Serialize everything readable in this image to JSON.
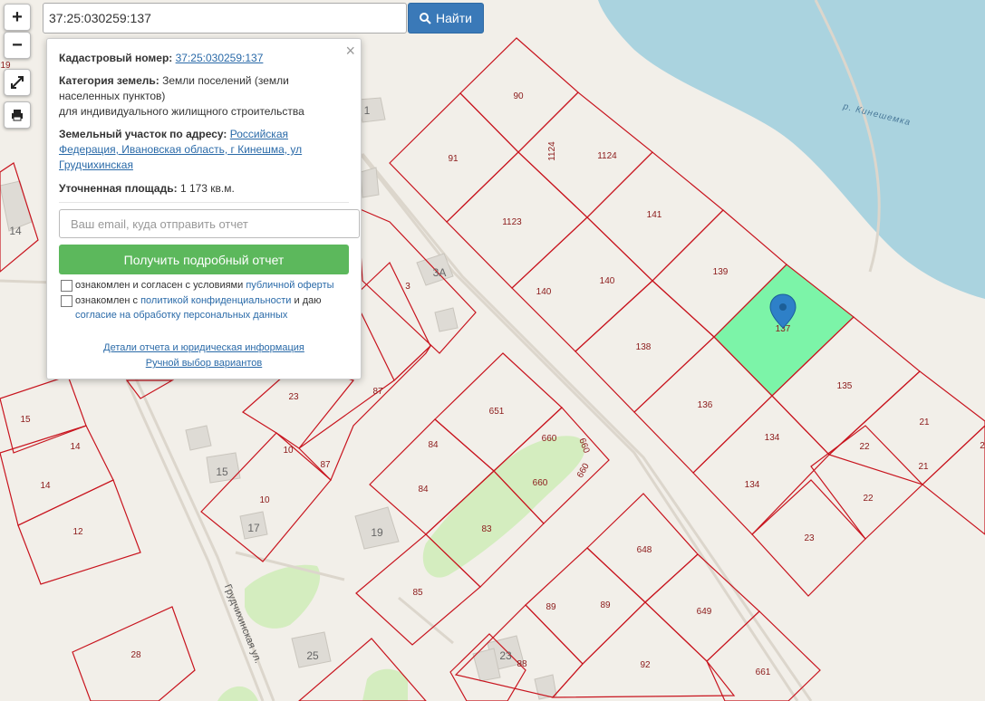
{
  "search": {
    "value": "37:25:030259:137",
    "button": "Найти"
  },
  "controls": {
    "zoom_in": "+",
    "zoom_out": "−"
  },
  "popup": {
    "close": "×",
    "cadastral_label": "Кадастровый номер:",
    "cadastral_value": "37:25:030259:137",
    "category_label": "Категория земель:",
    "category_value": "Земли поселений (земли населенных пунктов)",
    "category_use": "для индивидуального жилищного строительства",
    "address_label": "Земельный участок по адресу:",
    "address_value": "Российская Федерация, Ивановская область, г Кинешма, ул Грудчихинская",
    "area_label": "Уточненная площадь:",
    "area_value": "1 173 кв.м.",
    "email_placeholder": "Ваш email, куда отправить отчет",
    "report_button": "Получить подробный отчет",
    "check1_text": "ознакомлен и согласен с условиями",
    "check1_link": "публичной оферты",
    "check2_text": "ознакомлен с",
    "check2_link": "политикой конфиденциальности",
    "check2_and": "и даю",
    "check2_link2": "согласие на обработку персональных данных",
    "details_link": "Детали отчета и юридическая информация",
    "manual_link": "Ручной выбор вариантов"
  },
  "map": {
    "river_label": "р. Кинешемка",
    "street_label": "Грудчихинская ул.",
    "colors": {
      "background": "#f2efe9",
      "water": "#aad3df",
      "parcel": "#c8141e",
      "selected": "#7cf4a8",
      "green": "#d4edbf",
      "marker": "#2e80c8"
    },
    "parcels": [
      "90",
      "91",
      "1124",
      "1124",
      "1123",
      "141",
      "140",
      "140",
      "139",
      "137",
      "138",
      "136",
      "135",
      "134",
      "134",
      "21",
      "21",
      "22",
      "22",
      "23",
      "651",
      "660",
      "660",
      "660",
      "660",
      "84",
      "84",
      "83",
      "85",
      "648",
      "649",
      "89",
      "89",
      "92",
      "661",
      "88",
      "87",
      "87",
      "23",
      "10",
      "10",
      "15",
      "14",
      "14",
      "12",
      "28",
      "3",
      "14"
    ],
    "buildings": [
      "1",
      "14",
      "3A",
      "15",
      "17",
      "19",
      "25",
      "23"
    ],
    "edge_numbers": [
      "19",
      "2"
    ]
  }
}
